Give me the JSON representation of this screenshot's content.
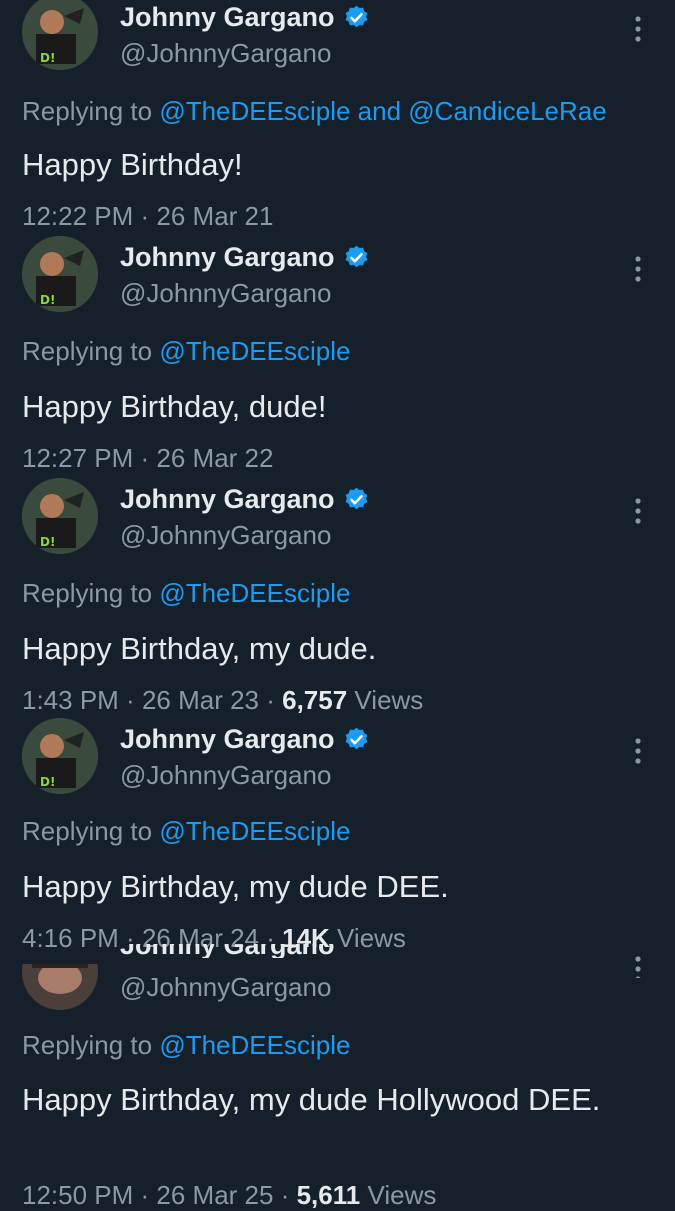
{
  "tweets": [
    {
      "name": "Johnny Gargano",
      "handle": "@JohnnyGargano",
      "replying_prefix": "Replying to ",
      "mention1": "@TheDEEsciple",
      "and_word": " and ",
      "mention2": "@CandiceLeRae",
      "text": "Happy Birthday!",
      "time": "12:22 PM",
      "sep1": " · ",
      "date": "26 Mar 21"
    },
    {
      "name": "Johnny Gargano",
      "handle": "@JohnnyGargano",
      "replying_prefix": "Replying to ",
      "mention1": "@TheDEEsciple",
      "text": "Happy Birthday, dude!",
      "time": "12:27 PM",
      "sep1": " · ",
      "date": "26 Mar 22"
    },
    {
      "name": "Johnny Gargano",
      "handle": "@JohnnyGargano",
      "replying_prefix": "Replying to ",
      "mention1": "@TheDEEsciple",
      "text": "Happy Birthday, my dude.",
      "time": "1:43 PM",
      "sep1": " · ",
      "date": "26 Mar 23",
      "sep2": " · ",
      "views_count": "6,757",
      "views_label": " Views"
    },
    {
      "name": "Johnny Gargano",
      "handle": "@JohnnyGargano",
      "replying_prefix": "Replying to ",
      "mention1": "@TheDEEsciple",
      "text": "Happy Birthday, my dude DEE.",
      "time": "4:16 PM",
      "sep1": " · ",
      "date": "26 Mar 24",
      "sep2": " · ",
      "views_count": "14K",
      "views_label": " Views"
    },
    {
      "name": "Johnny Gargano",
      "handle": "@JohnnyGargano",
      "replying_prefix": "Replying to ",
      "mention1": "@TheDEEsciple",
      "text": "Happy Birthday, my dude Hollywood DEE.",
      "time": "12:50 PM",
      "sep1": " · ",
      "date": "26 Mar 25",
      "sep2": " · ",
      "views_count": "5,611",
      "views_label": " Views"
    }
  ],
  "icons": {
    "verified": "verified-badge-icon",
    "more": "more-options-icon"
  },
  "colors": {
    "background": "#15202b",
    "text": "#e7e9ea",
    "secondary": "#8b98a5",
    "accent": "#1d9bf0"
  }
}
